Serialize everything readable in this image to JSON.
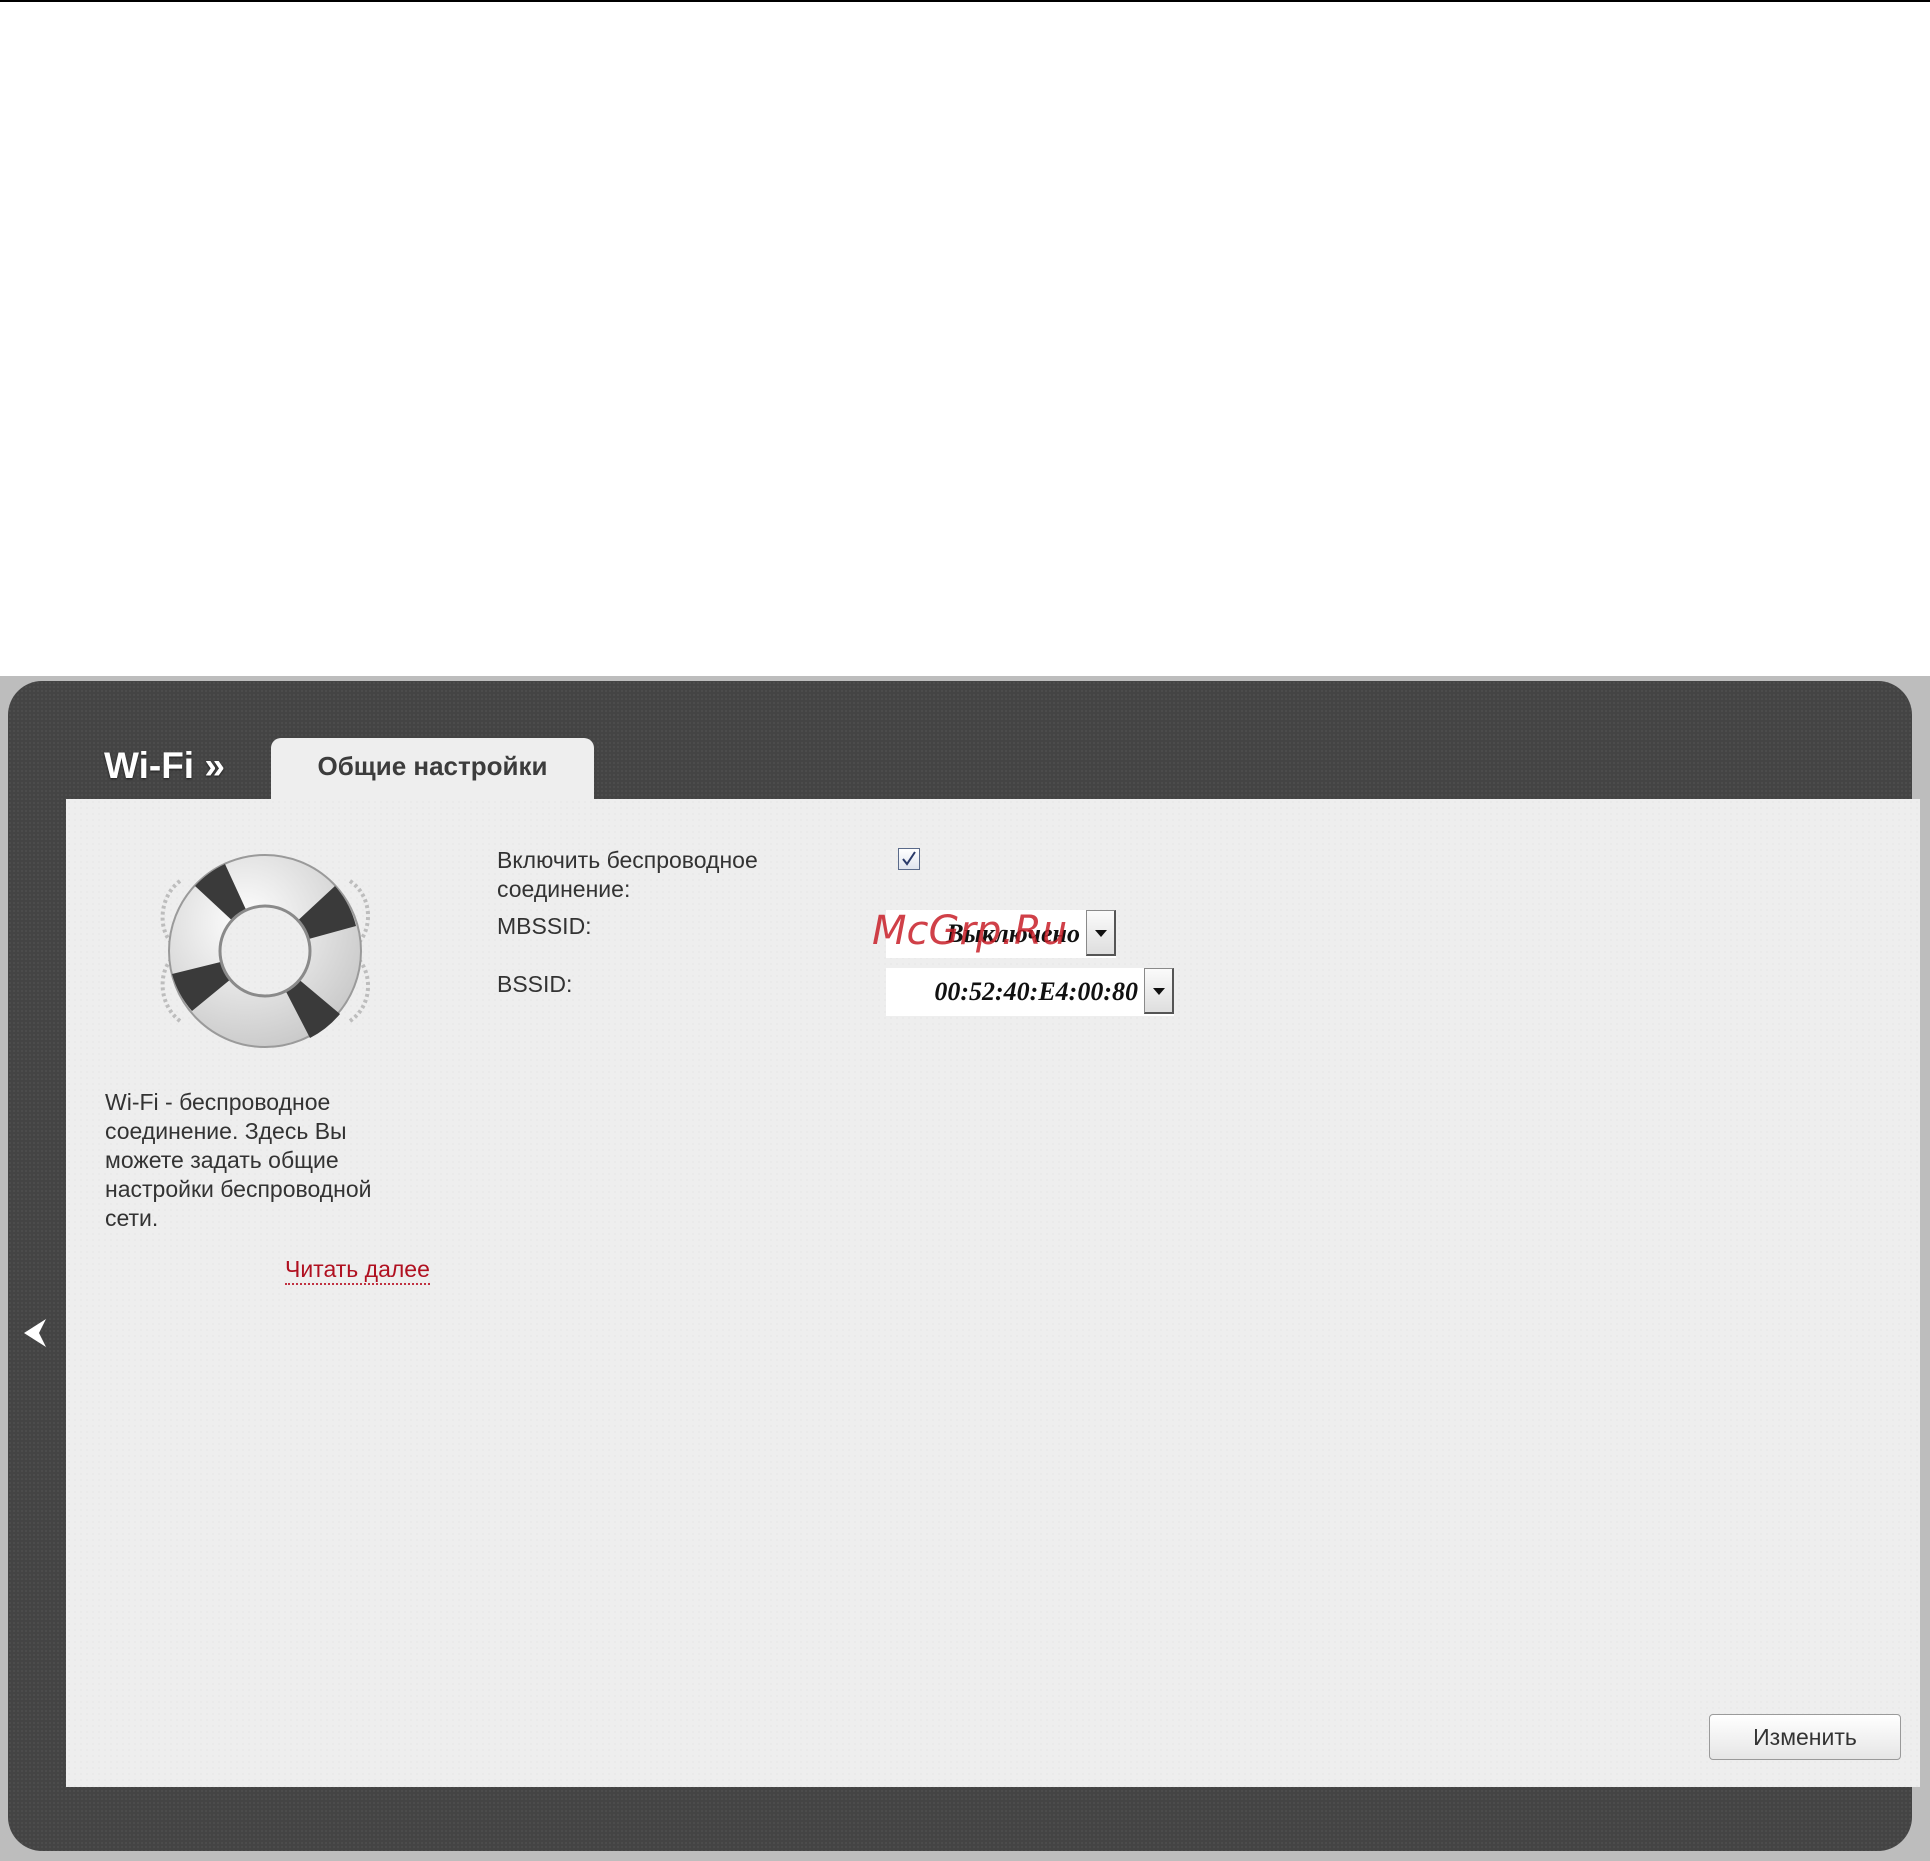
{
  "header": {
    "section_title": "Wi-Fi »",
    "tab_label": "Общие настройки"
  },
  "sidebar": {
    "description": "Wi-Fi - беспроводное соединение. Здесь Вы можете задать общие настройки беспроводной сети.",
    "read_more": "Читать далее"
  },
  "form": {
    "enable_label_line1": "Включить беспроводное",
    "enable_label_line2": "соединение:",
    "enable_checked": true,
    "mbssid_label": "MBSSID:",
    "mbssid_value": "Выключено",
    "bssid_label": "BSSID:",
    "bssid_value": "00:52:40:E4:00:80"
  },
  "buttons": {
    "change": "Изменить"
  },
  "watermark": "McGrp.Ru",
  "icons": {
    "nav_back": "chevron-left-icon",
    "help": "lifebuoy-icon"
  },
  "colors": {
    "frame": "#444444",
    "content": "#eeeeee",
    "link": "#b01020"
  }
}
